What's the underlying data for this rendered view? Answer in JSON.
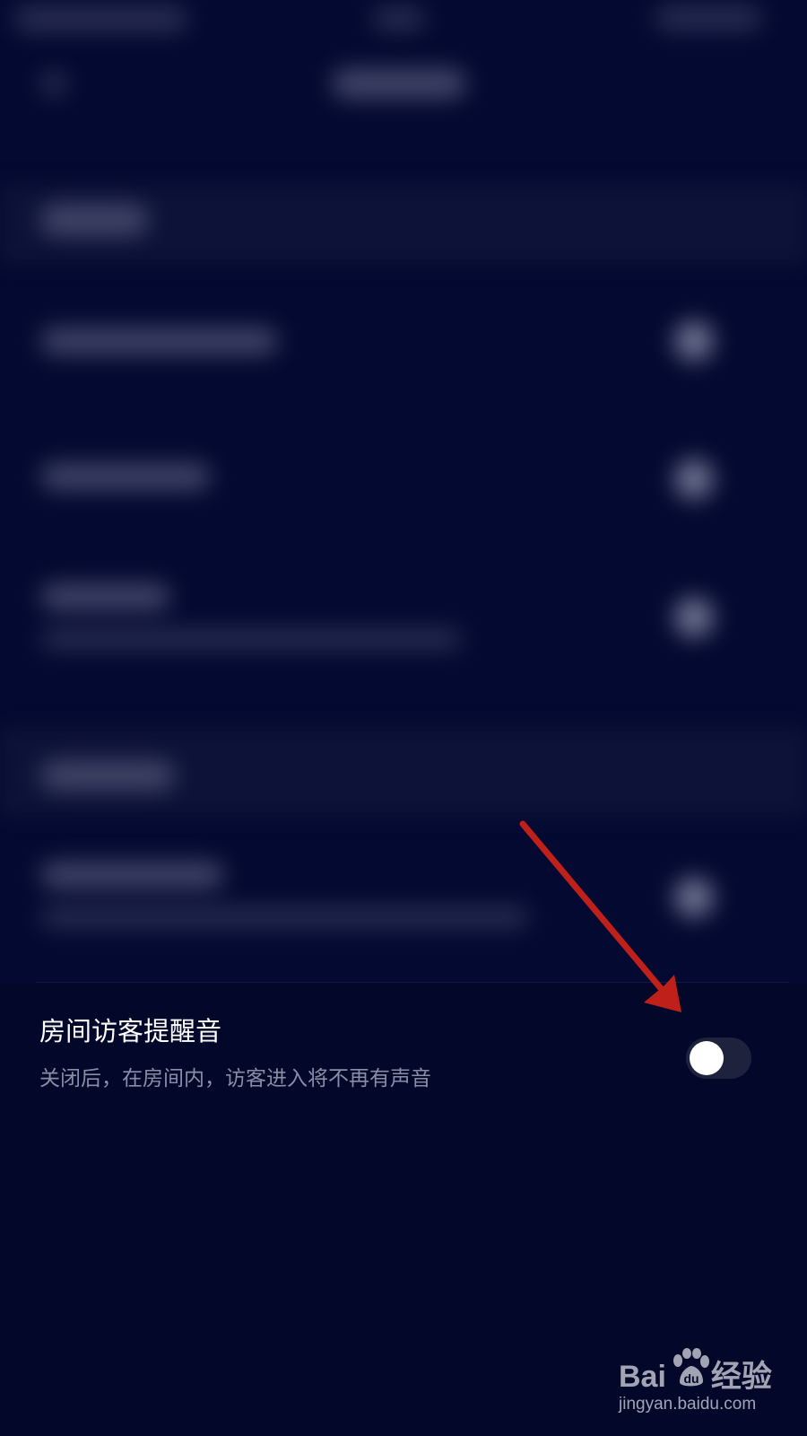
{
  "setting": {
    "title": "房间访客提醒音",
    "description": "关闭后，在房间内，访客进入将不再有声音",
    "enabled": false
  },
  "watermark": {
    "brand_prefix": "Bai",
    "brand_suffix": "经验",
    "url": "jingyan.baidu.com"
  },
  "colors": {
    "background": "#03072a",
    "annotation_arrow": "#c0201a",
    "toggle_track": "#1e223d",
    "toggle_knob": "#ffffff"
  },
  "icons": {
    "watermark": "baidu-paw-icon",
    "annotation": "red-arrow"
  }
}
